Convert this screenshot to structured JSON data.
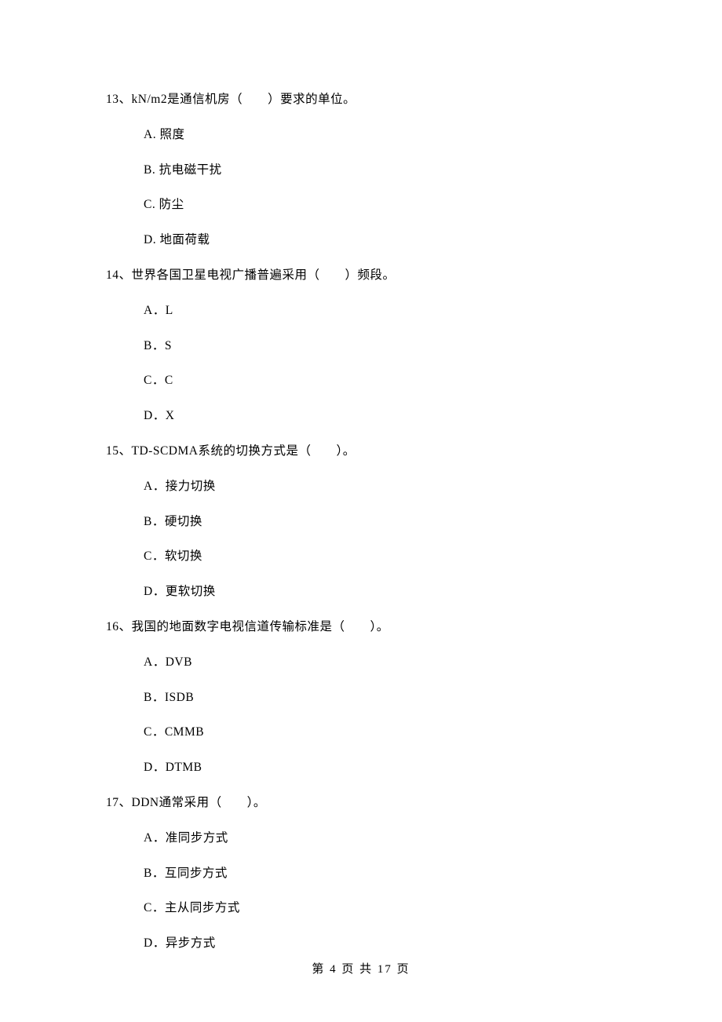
{
  "questions": [
    {
      "number": "13、",
      "text": "kN/m2是通信机房（　　）要求的单位。",
      "options": [
        {
          "label": "A.",
          "text": "照度"
        },
        {
          "label": "B.",
          "text": "抗电磁干扰"
        },
        {
          "label": "C.",
          "text": "防尘"
        },
        {
          "label": "D.",
          "text": "地面荷载"
        }
      ]
    },
    {
      "number": "14、",
      "text": "世界各国卫星电视广播普遍采用（　　）频段。",
      "options": [
        {
          "label": "A．",
          "text": "L"
        },
        {
          "label": "B．",
          "text": "S"
        },
        {
          "label": "C．",
          "text": "C"
        },
        {
          "label": "D．",
          "text": "X"
        }
      ]
    },
    {
      "number": "15、",
      "text": "TD-SCDMA系统的切换方式是（　　）。",
      "options": [
        {
          "label": "A．",
          "text": "接力切换"
        },
        {
          "label": "B．",
          "text": "硬切换"
        },
        {
          "label": "C．",
          "text": "软切换"
        },
        {
          "label": "D．",
          "text": "更软切换"
        }
      ]
    },
    {
      "number": "16、",
      "text": "我国的地面数字电视信道传输标准是（　　）。",
      "options": [
        {
          "label": "A．",
          "text": "DVB"
        },
        {
          "label": "B．",
          "text": "ISDB"
        },
        {
          "label": "C．",
          "text": "CMMB"
        },
        {
          "label": "D．",
          "text": "DTMB"
        }
      ]
    },
    {
      "number": "17、",
      "text": "DDN通常采用（　　）。",
      "options": [
        {
          "label": "A．",
          "text": "准同步方式"
        },
        {
          "label": "B．",
          "text": "互同步方式"
        },
        {
          "label": "C．",
          "text": "主从同步方式"
        },
        {
          "label": "D．",
          "text": "异步方式"
        }
      ]
    }
  ],
  "footer": "第 4 页 共 17 页"
}
